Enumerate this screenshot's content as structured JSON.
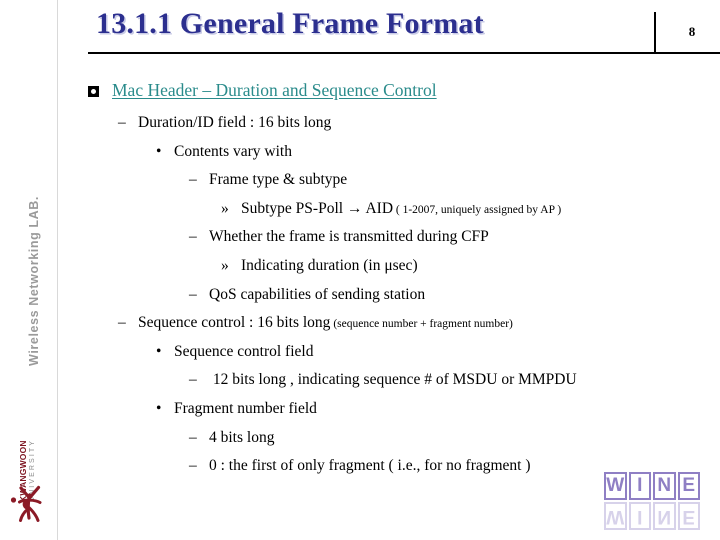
{
  "slide": {
    "title": "13.1.1 General Frame Format",
    "page_number": "8",
    "title_color": "#2c2f8f",
    "heading_color": "#2a8b8b"
  },
  "sidebar": {
    "lab_name": "Wireless Networking LAB.",
    "university_name": "KWANGWOON",
    "university_subtitle": "UNIVERSITY",
    "logo_icon": "kwangwoon-figure-icon",
    "logo_color": "#7d1420"
  },
  "content": {
    "heading": {
      "bullet_icon": "square-bullet-icon",
      "text": "Mac Header – Duration and Sequence Control"
    },
    "lines": [
      {
        "level": 2,
        "marker": "–",
        "text": "Duration/ID field : 16 bits long",
        "small": ""
      },
      {
        "level": 3,
        "marker": "•",
        "text": "Contents vary with",
        "small": ""
      },
      {
        "level": 4,
        "marker": "–",
        "text": "Frame type & subtype",
        "small": ""
      },
      {
        "level": 5,
        "marker": "»",
        "text": "Subtype PS-Poll → AID",
        "small": "( 1-2007, uniquely assigned by AP )"
      },
      {
        "level": 4,
        "marker": "–",
        "text": "Whether the frame is transmitted during CFP",
        "small": ""
      },
      {
        "level": 5,
        "marker": "»",
        "text": "Indicating duration (in μsec)",
        "small": ""
      },
      {
        "level": 4,
        "marker": "–",
        "text": "QoS capabilities of sending station",
        "small": ""
      },
      {
        "level": 2,
        "marker": "–",
        "text": "Sequence control : 16 bits long",
        "small": "(sequence number + fragment number)"
      },
      {
        "level": 3,
        "marker": "•",
        "text": "Sequence control field",
        "small": ""
      },
      {
        "level": 4,
        "marker": "–",
        "text": " 12 bits long , indicating sequence # of MSDU or MMPDU",
        "small": ""
      },
      {
        "level": 3,
        "marker": "•",
        "text": "Fragment number field",
        "small": ""
      },
      {
        "level": 4,
        "marker": "–",
        "text": "4 bits long",
        "small": ""
      },
      {
        "level": 4,
        "marker": "–",
        "text": "0 : the first of only fragment ( i.e., for no fragment )",
        "small": ""
      }
    ]
  },
  "watermark": {
    "letters": [
      "W",
      "I",
      "N",
      "E"
    ],
    "color": "#8f7fc4"
  }
}
